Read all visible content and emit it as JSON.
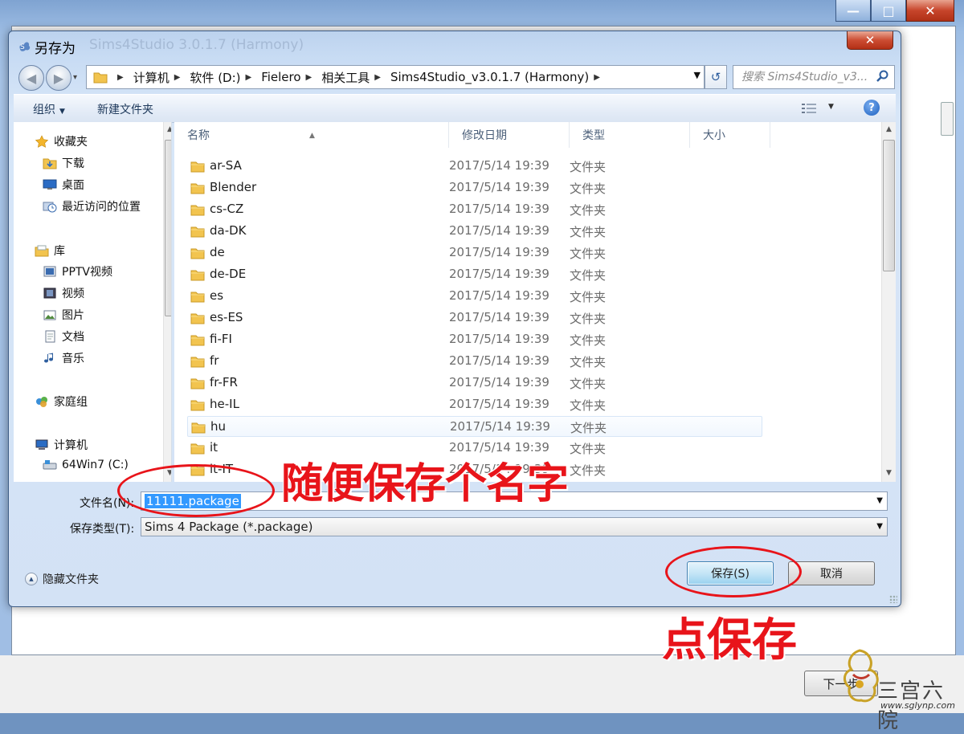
{
  "background_window": {
    "caption_buttons": [
      {
        "name": "minimize",
        "glyph": "—"
      },
      {
        "name": "maximize",
        "glyph": "□"
      },
      {
        "name": "close",
        "glyph": "✕"
      }
    ],
    "next_button_label": "下一步",
    "watermark": {
      "chars": "三宫六院",
      "url": "www.sglynp.com"
    }
  },
  "dialog": {
    "title": "另存为",
    "ghost_title": "Sims4Studio 3.0.1.7 (Harmony)",
    "close_glyph": "✕",
    "address": {
      "breadcrumbs": [
        "计算机",
        "软件 (D:)",
        "Fielero",
        "相关工具",
        "Sims4Studio_v3.0.1.7 (Harmony)"
      ]
    },
    "search": {
      "placeholder": "搜索 Sims4Studio_v3..."
    },
    "toolbar": {
      "organize": "组织",
      "new_folder": "新建文件夹",
      "help": "?"
    },
    "nav": {
      "favorites": {
        "label": "收藏夹",
        "items": [
          "下载",
          "桌面",
          "最近访问的位置"
        ]
      },
      "libraries": {
        "label": "库",
        "items": [
          "PPTV视频",
          "视频",
          "图片",
          "文档",
          "音乐"
        ]
      },
      "homegroup": {
        "label": "家庭组"
      },
      "computer": {
        "label": "计算机",
        "items": [
          "64Win7  (C:)"
        ]
      }
    },
    "columns": {
      "name": "名称",
      "date": "修改日期",
      "type": "类型",
      "size": "大小"
    },
    "files": [
      {
        "name": "ar-SA",
        "date": "2017/5/14 19:39",
        "type": "文件夹"
      },
      {
        "name": "Blender",
        "date": "2017/5/14 19:39",
        "type": "文件夹"
      },
      {
        "name": "cs-CZ",
        "date": "2017/5/14 19:39",
        "type": "文件夹"
      },
      {
        "name": "da-DK",
        "date": "2017/5/14 19:39",
        "type": "文件夹"
      },
      {
        "name": "de",
        "date": "2017/5/14 19:39",
        "type": "文件夹"
      },
      {
        "name": "de-DE",
        "date": "2017/5/14 19:39",
        "type": "文件夹"
      },
      {
        "name": "es",
        "date": "2017/5/14 19:39",
        "type": "文件夹"
      },
      {
        "name": "es-ES",
        "date": "2017/5/14 19:39",
        "type": "文件夹"
      },
      {
        "name": "fi-FI",
        "date": "2017/5/14 19:39",
        "type": "文件夹"
      },
      {
        "name": "fr",
        "date": "2017/5/14 19:39",
        "type": "文件夹"
      },
      {
        "name": "fr-FR",
        "date": "2017/5/14 19:39",
        "type": "文件夹"
      },
      {
        "name": "he-IL",
        "date": "2017/5/14 19:39",
        "type": "文件夹"
      },
      {
        "name": "hu",
        "date": "2017/5/14 19:39",
        "type": "文件夹"
      },
      {
        "name": "it",
        "date": "2017/5/14 19:39",
        "type": "文件夹"
      },
      {
        "name": "it-IT",
        "date": "2017/5/14 19:39",
        "type": "文件夹"
      }
    ],
    "selected_file_index": 12,
    "filename": {
      "label": "文件名(N):",
      "value": "11111.package"
    },
    "filetype": {
      "label": "保存类型(T):",
      "value": "Sims 4 Package (*.package)"
    },
    "hide_folders": "隐藏文件夹",
    "save_button": "保存(S)",
    "cancel_button": "取消"
  },
  "annotations": {
    "filename_hint": "随便保存个名字",
    "save_hint": "点保存",
    "color": "#e8141a"
  },
  "colors": {
    "accent_blue": "#3399ff",
    "folder_yellow": "#f2c44f",
    "frame_blue": "#7fa3d1"
  }
}
